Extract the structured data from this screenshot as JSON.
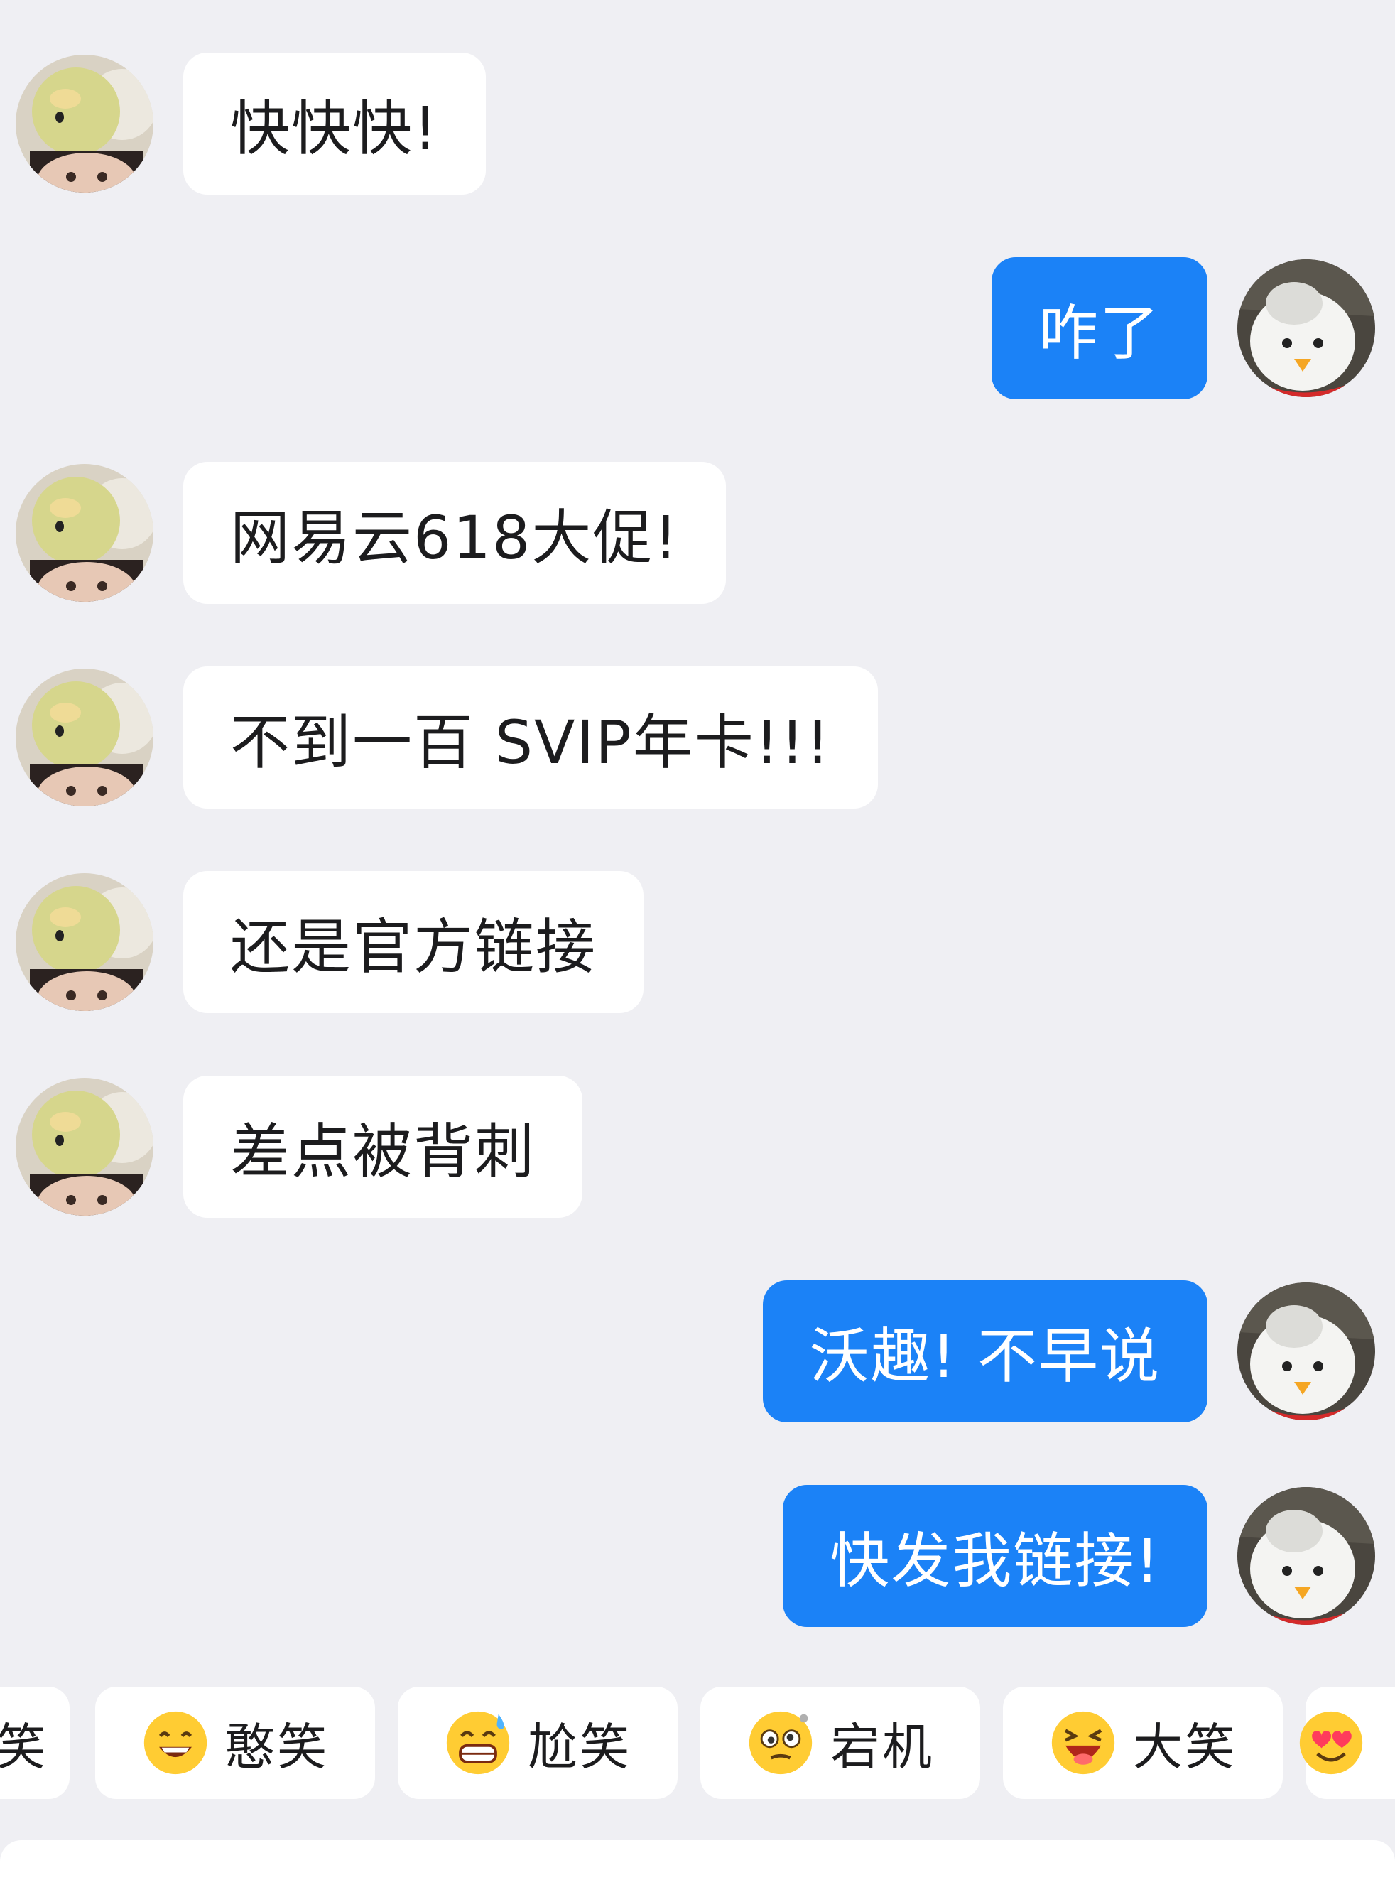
{
  "messages": [
    {
      "side": "left",
      "text": "快快快!"
    },
    {
      "side": "right",
      "text": "咋了"
    },
    {
      "side": "left",
      "text": "网易云618大促!"
    },
    {
      "side": "left",
      "text": "不到一百 SVIP年卡!!!"
    },
    {
      "side": "left",
      "text": "还是官方链接"
    },
    {
      "side": "left",
      "text": "差点被背刺"
    },
    {
      "side": "right",
      "text": "沃趣! 不早说"
    },
    {
      "side": "right",
      "text": "快发我链接!"
    }
  ],
  "quick_replies": [
    {
      "label": "笑",
      "emoji": "smile-emoji-icon"
    },
    {
      "label": "憨笑",
      "emoji": "grin-emoji-icon"
    },
    {
      "label": "尬笑",
      "emoji": "sweat-grin-emoji-icon"
    },
    {
      "label": "宕机",
      "emoji": "dizzy-emoji-icon"
    },
    {
      "label": "大笑",
      "emoji": "laughing-emoji-icon"
    },
    {
      "label": "",
      "emoji": "heart-eyes-emoji-icon"
    }
  ],
  "colors": {
    "background": "#efeff3",
    "incoming_bubble": "#ffffff",
    "outgoing_bubble": "#1b82f7",
    "text": "#1c1c1e",
    "emoji_yellow": "#ffcc33"
  }
}
